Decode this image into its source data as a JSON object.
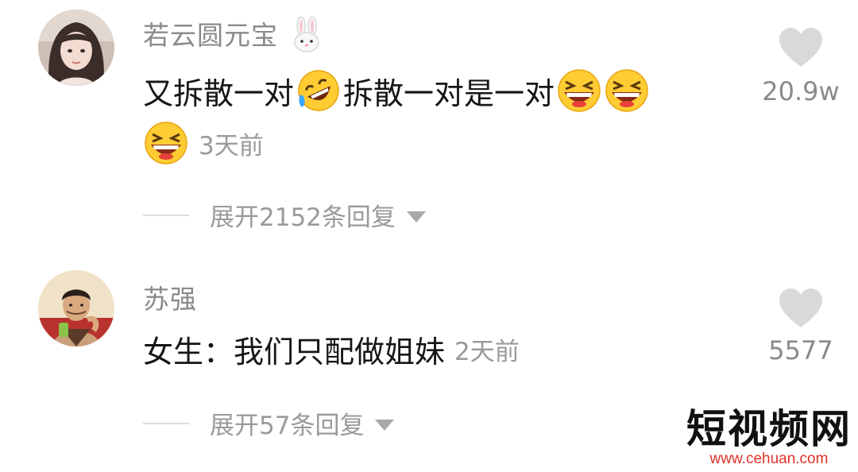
{
  "comments": [
    {
      "username": "若云圆元宝",
      "text_part1": "又拆散一对",
      "text_part2": "拆散一对是一对",
      "time": "3天前",
      "likes": "20.9w",
      "expand_label": "展开2152条回复"
    },
    {
      "username": "苏强",
      "text": "女生：我们只配做姐妹",
      "time": "2天前",
      "likes": "5577",
      "expand_label": "展开57条回复"
    }
  ],
  "watermark": {
    "title": "短视频网",
    "url": "www.cehuan.com"
  },
  "colors": {
    "username": "#8a8a8a",
    "text": "#161616",
    "meta": "#9a9a9a",
    "watermark_url": "#e0312a"
  },
  "icons": [
    "avatar",
    "rabbit-icon",
    "rofl-emoji",
    "laughing-emoji",
    "heart-icon",
    "caret-down-icon"
  ]
}
